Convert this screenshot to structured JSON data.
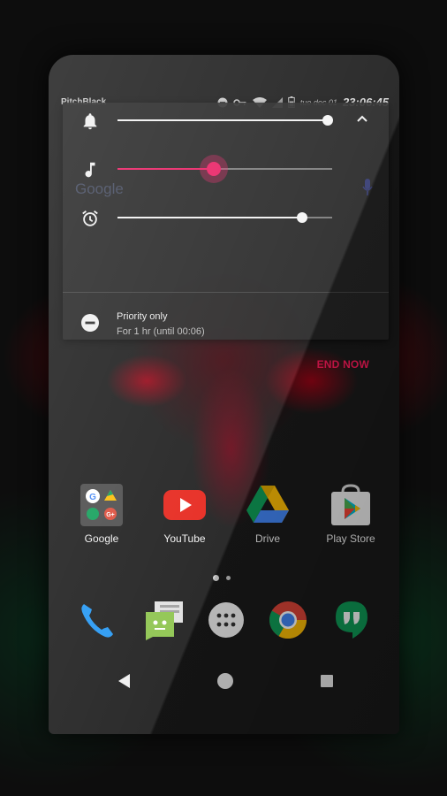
{
  "status_bar": {
    "carrier": "PitchBlack",
    "date": "tue dec 01",
    "time": "23:06:45"
  },
  "volume_panel": {
    "ringer": {
      "icon": "bell-icon",
      "level": 0.98
    },
    "media": {
      "icon": "music-note-icon",
      "level": 0.45,
      "accent": "#e91e63"
    },
    "alarm": {
      "icon": "alarm-clock-icon",
      "level": 0.86
    },
    "expand_icon": "chevron-up-icon",
    "priority": {
      "icon": "do-not-disturb-icon",
      "title": "Priority only",
      "subtitle": "For 1 hr (until 00:06)"
    },
    "end_now_label": "END NOW"
  },
  "search_bar": {
    "logo_text": "Google"
  },
  "home_apps": [
    {
      "label": "Google",
      "icon": "google-folder-icon"
    },
    {
      "label": "YouTube",
      "icon": "youtube-icon"
    },
    {
      "label": "Drive",
      "icon": "drive-icon"
    },
    {
      "label": "Play Store",
      "icon": "play-store-icon"
    }
  ],
  "page_indicator": {
    "pages": 2,
    "current": 1
  },
  "dock": [
    {
      "icon": "phone-icon"
    },
    {
      "icon": "messenger-icon"
    },
    {
      "icon": "app-drawer-icon"
    },
    {
      "icon": "chrome-icon"
    },
    {
      "icon": "hangouts-icon"
    }
  ],
  "nav_bar": [
    "back-icon",
    "home-icon",
    "recents-icon"
  ],
  "colors": {
    "accent_pink": "#e91e63",
    "end_now_red": "#ff1a5a"
  }
}
